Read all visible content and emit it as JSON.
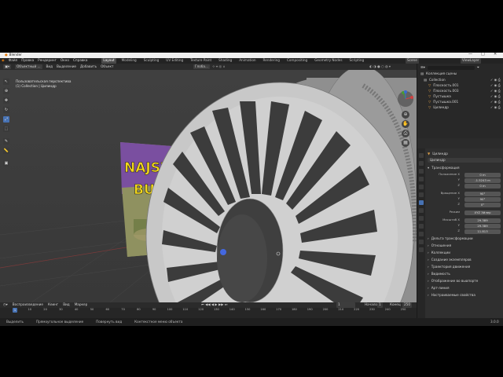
{
  "titlebar": {
    "title": "Blender",
    "minimize": "—",
    "maximize": "□",
    "close": "✕"
  },
  "menubar": {
    "items": [
      "Файл",
      "Правка",
      "Рендеринг",
      "Окно",
      "Справка"
    ],
    "workspaces": [
      "Layout",
      "Modeling",
      "Sculpting",
      "UV Editing",
      "Texture Paint",
      "Shading",
      "Animation",
      "Rendering",
      "Compositing",
      "Geometry Nodes",
      "Scripting"
    ],
    "active_workspace": "Layout",
    "scene": "Scene",
    "view_layer": "ViewLayer"
  },
  "viewport_header": {
    "mode": "Объектный ...",
    "menus": [
      "Вид",
      "Выделение",
      "Добавить",
      "Объект"
    ],
    "transform": "Глоба..."
  },
  "tool_header": {
    "orientation_label": "Ориентация:",
    "orientation_value": "По умолч...",
    "drag_label": "Drag:",
    "drag_value": "Select Box",
    "options": "Опции ▾"
  },
  "viewport": {
    "view_name": "Пользовательская перспектива",
    "collection": "(1) Collection | Цилиндр",
    "billboard_text_1": "NAJSZYBS",
    "billboard_text_2": "BUGG"
  },
  "timeline": {
    "menus": [
      "Воспроизведение",
      "Кеинг",
      "Вид",
      "Маркер"
    ],
    "current_frame": "1",
    "start_label": "Начало",
    "start": "1",
    "end_label": "Конец",
    "end": "250",
    "ticks": [
      "0",
      "10",
      "20",
      "30",
      "40",
      "50",
      "60",
      "70",
      "80",
      "90",
      "100",
      "110",
      "120",
      "130",
      "140",
      "150",
      "160",
      "170",
      "180",
      "190",
      "200",
      "210",
      "220",
      "230",
      "240",
      "250"
    ]
  },
  "statusbar": {
    "items": [
      "Выделить",
      "Прямоугольное выделение",
      "Повернуть вид",
      "Контекстное меню объекта"
    ],
    "version": "3.0.0"
  },
  "outliner": {
    "root": "Коллекция сцены",
    "items": [
      {
        "name": "Collection",
        "depth": 0,
        "color": "#cfcfcf"
      },
      {
        "name": "Плоскость.001",
        "depth": 1,
        "color": "#e0a24a"
      },
      {
        "name": "Плоскость.003",
        "depth": 1,
        "color": "#e0a24a"
      },
      {
        "name": "Пустышка",
        "depth": 1,
        "color": "#e0a24a"
      },
      {
        "name": "Пустышка.001",
        "depth": 1,
        "color": "#e0a24a"
      },
      {
        "name": "Цилиндр",
        "depth": 1,
        "color": "#e0a24a"
      }
    ]
  },
  "properties": {
    "object_name": "Цилиндр",
    "data_name": "Цилиндр",
    "transform_section": "Трансформация",
    "fields": [
      {
        "label": "Положение X",
        "value": "0 m"
      },
      {
        "label": "Y",
        "value": "-1.5243 m"
      },
      {
        "label": "Z",
        "value": "0 m"
      },
      {
        "label": "Вращение X",
        "value": "90°"
      },
      {
        "label": "Y",
        "value": "90°"
      },
      {
        "label": "Z",
        "value": "0°"
      },
      {
        "label": "Режим",
        "value": "XYZ Эйлер"
      },
      {
        "label": "Масштаб X",
        "value": "29.389"
      },
      {
        "label": "Y",
        "value": "29.389"
      },
      {
        "label": "Z",
        "value": "11.813"
      }
    ],
    "sections": [
      "Дельта трансформации",
      "Отношения",
      "Коллекции",
      "Создание экземпляров",
      "Траектория движения",
      "Видимость",
      "Отображение во вьюпорте",
      "Арт-линия",
      "Настраиваемые свойства"
    ]
  }
}
